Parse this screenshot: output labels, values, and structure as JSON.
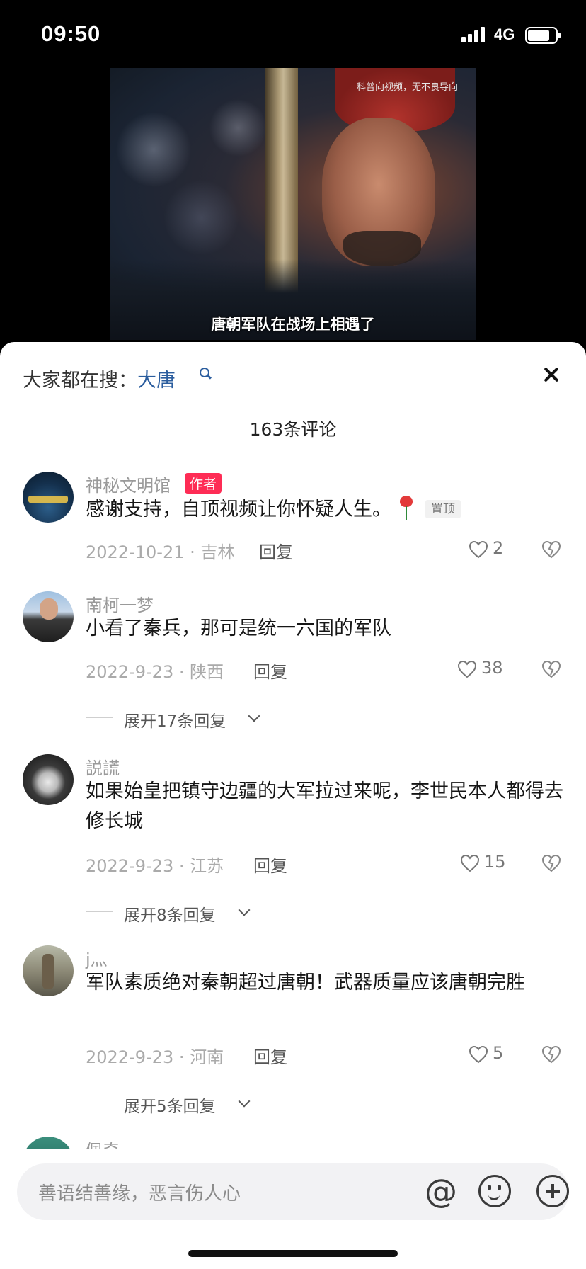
{
  "status_bar": {
    "time": "09:50",
    "network": "4G",
    "battery_level": 0.78
  },
  "video": {
    "watermark": "科普向视频，无不良导向",
    "subtitle": "唐朝军队在战场上相遇了"
  },
  "sheet": {
    "search_prefix": "大家都在搜：",
    "search_term": "大唐",
    "comment_count": "163条评论"
  },
  "comments": [
    {
      "username": "神秘文明馆",
      "author_tag": "作者",
      "text": "感谢支持，自顶视频让你怀疑人生。",
      "pinned_tag": "置顶",
      "date_location": "2022-10-21 · 吉林",
      "reply_label": "回复",
      "likes": "2"
    },
    {
      "username": "南柯一梦",
      "text": "小看了秦兵，那可是统一六国的军队",
      "date_location": "2022-9-23 · 陕西",
      "reply_label": "回复",
      "likes": "38",
      "expand_label": "展开17条回复"
    },
    {
      "username": "説謊",
      "text": "如果始皇把镇守边疆的大军拉过来呢，李世民本人都得去修长城",
      "date_location": "2022-9-23 · 江苏",
      "reply_label": "回复",
      "likes": "15",
      "expand_label": "展开8条回复"
    },
    {
      "username": "j灬",
      "text": "军队素质绝对秦朝超过唐朝！武器质量应该唐朝完胜",
      "date_location": "2022-9-23 · 河南",
      "reply_label": "回复",
      "likes": "5",
      "expand_label": "展开5条回复"
    },
    {
      "username": "佩奇"
    }
  ],
  "input": {
    "placeholder": "善语结善缘，恶言伤人心"
  }
}
